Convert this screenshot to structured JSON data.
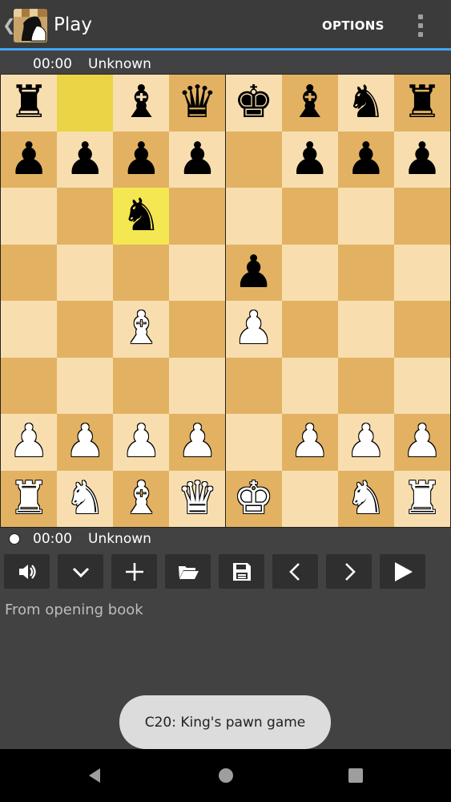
{
  "appbar": {
    "title": "Play",
    "options_label": "OPTIONS"
  },
  "top_player": {
    "clock": "00:00",
    "name": "Unknown"
  },
  "bottom_player": {
    "clock": "00:00",
    "name": "Unknown"
  },
  "board": {
    "light_color": "#f8deaf",
    "dark_color": "#e2b262",
    "highlight_color": "#f4e752",
    "highlighted_squares": [
      "b8",
      "c6"
    ],
    "ranks": [
      [
        "r",
        "",
        "b",
        "q",
        "k",
        "b",
        "n",
        "r"
      ],
      [
        "p",
        "p",
        "p",
        "p",
        "",
        "p",
        "p",
        "p"
      ],
      [
        "",
        "",
        "n",
        "",
        "",
        "",
        "",
        ""
      ],
      [
        "",
        "",
        "",
        "",
        "p",
        "",
        "",
        ""
      ],
      [
        "",
        "",
        "B",
        "",
        "P",
        "",
        "",
        ""
      ],
      [
        "",
        "",
        "",
        "",
        "",
        "",
        "",
        ""
      ],
      [
        "P",
        "P",
        "P",
        "P",
        "",
        "P",
        "P",
        "P"
      ],
      [
        "R",
        "N",
        "B",
        "Q",
        "K",
        "",
        "N",
        "R"
      ]
    ]
  },
  "toolbar": {
    "buttons": [
      "sound-icon",
      "chevron-down-icon",
      "plus-icon",
      "folder-icon",
      "save-icon",
      "arrow-left-icon",
      "arrow-right-icon",
      "play-icon"
    ]
  },
  "status": {
    "text": "From opening book"
  },
  "toast": {
    "text": "C20: King's pawn game"
  },
  "navbar": {
    "buttons": [
      "back-icon",
      "home-icon",
      "recents-icon"
    ]
  }
}
